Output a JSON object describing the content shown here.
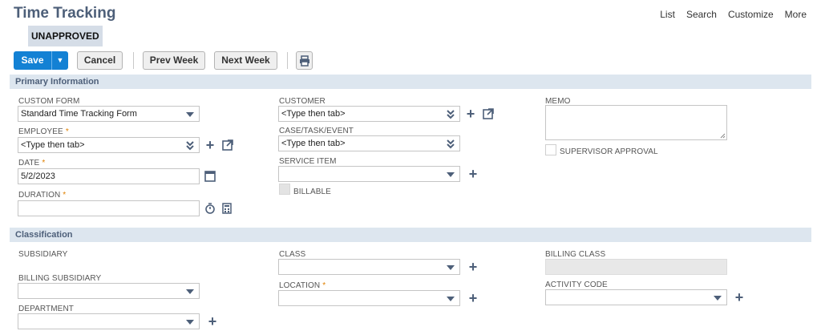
{
  "header": {
    "title": "Time Tracking",
    "nav": [
      "List",
      "Search",
      "Customize",
      "More"
    ],
    "status": "UNAPPROVED"
  },
  "toolbar": {
    "save_label": "Save",
    "cancel_label": "Cancel",
    "prev_week_label": "Prev Week",
    "next_week_label": "Next Week"
  },
  "primary": {
    "section_title": "Primary Information",
    "custom_form": {
      "label": "CUSTOM FORM",
      "value": "Standard Time Tracking Form"
    },
    "employee": {
      "label": "EMPLOYEE",
      "value": "<Type then tab>",
      "required_mark": "*"
    },
    "date": {
      "label": "DATE",
      "value": "5/2/2023",
      "required_mark": "*"
    },
    "duration": {
      "label": "DURATION",
      "value": "",
      "required_mark": "*"
    },
    "customer": {
      "label": "CUSTOMER",
      "value": "<Type then tab>"
    },
    "case_task_event": {
      "label": "CASE/TASK/EVENT",
      "value": "<Type then tab>"
    },
    "service_item": {
      "label": "SERVICE ITEM",
      "value": ""
    },
    "billable": {
      "label": "BILLABLE",
      "checked": false
    },
    "memo": {
      "label": "MEMO",
      "value": ""
    },
    "supervisor_approval": {
      "label": "SUPERVISOR APPROVAL",
      "checked": false
    }
  },
  "classification": {
    "section_title": "Classification",
    "subsidiary": {
      "label": "SUBSIDIARY"
    },
    "billing_subsidiary": {
      "label": "BILLING SUBSIDIARY",
      "value": ""
    },
    "department": {
      "label": "DEPARTMENT",
      "value": ""
    },
    "class": {
      "label": "CLASS",
      "value": ""
    },
    "location": {
      "label": "LOCATION",
      "value": "",
      "required_mark": "*"
    },
    "billing_class": {
      "label": "BILLING CLASS",
      "value": ""
    },
    "activity_code": {
      "label": "ACTIVITY CODE",
      "value": ""
    }
  },
  "colors": {
    "accent": "#1381d4",
    "title": "#4d5f79",
    "section_bg": "#dde6ef",
    "required": "#e08000"
  }
}
